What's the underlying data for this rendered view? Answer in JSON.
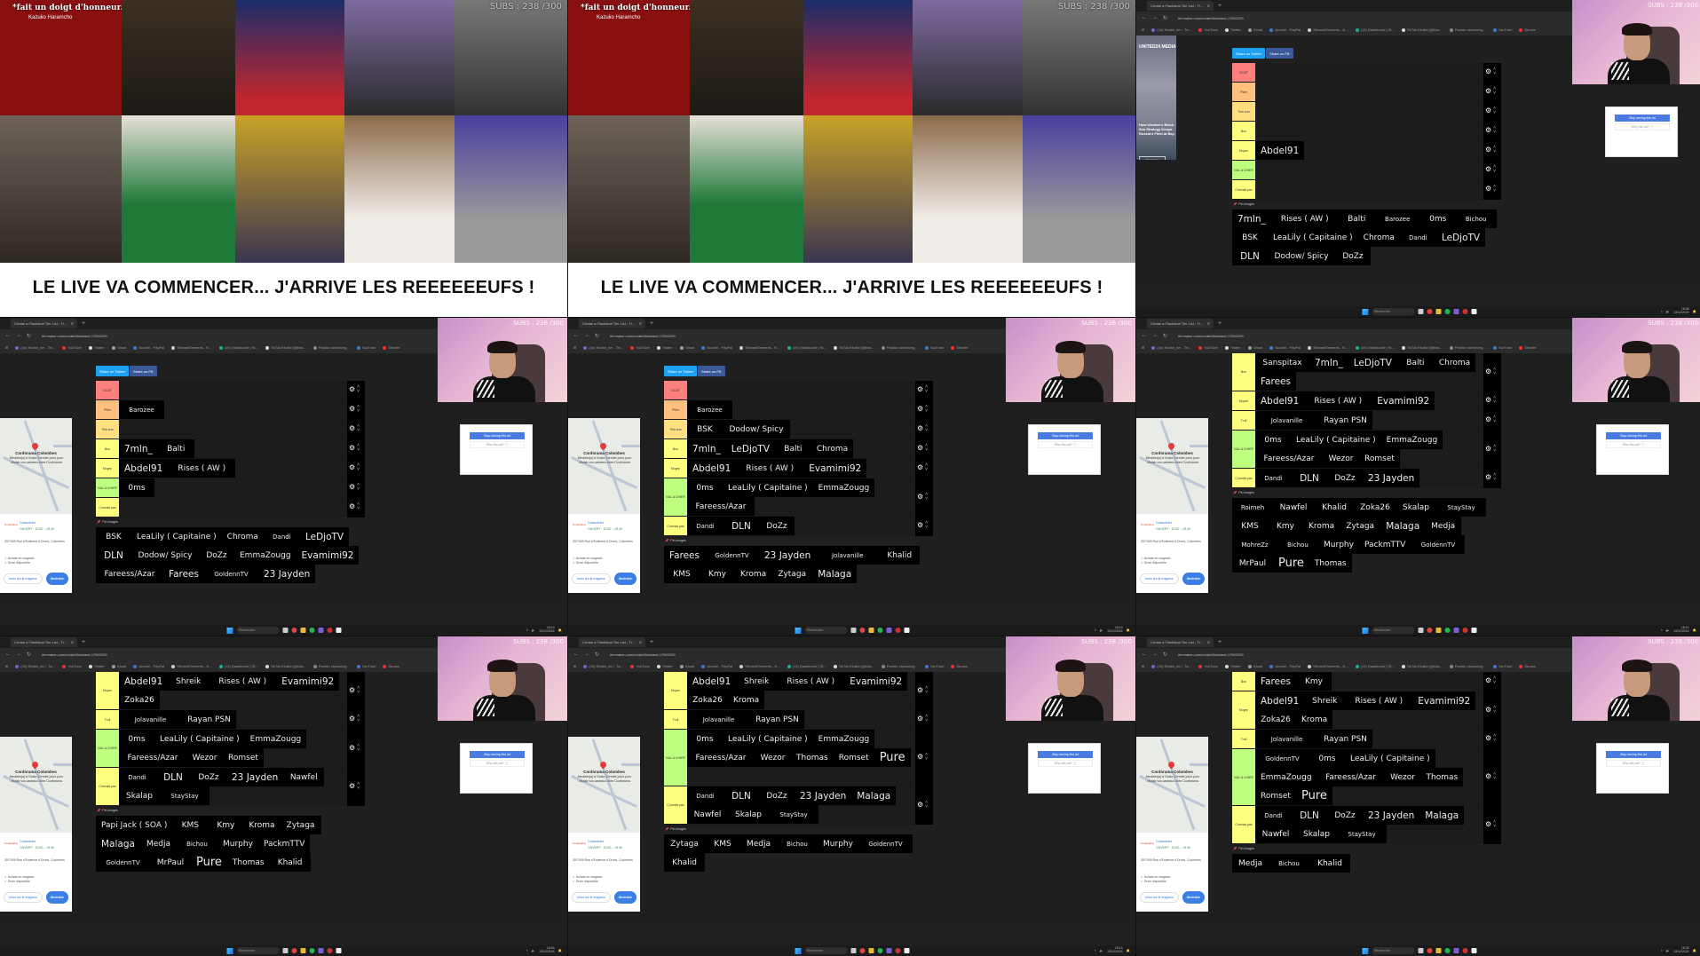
{
  "stream_overlay": {
    "subs_counter": "SUBS : 238 /300"
  },
  "intro": {
    "caption": "*fait un doigt d'honneur.*",
    "caption_sub": "Kazuko Haramcho",
    "banner": "LE LIVE VA COMMENCER... J'ARRIVE LES REEEEEEUFS !"
  },
  "browser": {
    "tab_title": "Create a Flashland Tier List - Ti...",
    "tab_close": "✕",
    "new_tab": "+",
    "url": "tiermaker.com/create/flashland-17592299",
    "bookmarks": [
      "(16) Khalid_rim - Tw...",
      "YouTube",
      "Twitter",
      "Gmail",
      "Accueil - PayPal",
      "StreamElements - N...",
      "(19) Dashboard | St...",
      "TikTok Khalid (@kha...",
      "Parrain streaming...",
      "YouTube",
      "Stream"
    ]
  },
  "tiermaker": {
    "share_twitter": "Share on Twitter",
    "share_fb": "Share on FB",
    "pin_images": "Pin Images",
    "gear_glyph": "⚙",
    "up_glyph": "˄",
    "down_glyph": "˅"
  },
  "ads": {
    "news": {
      "brand": "UNITED24 MEDIA",
      "headline": "How Ukraine's Black Sea Strategy Keeps Russia's Fleet at Bay",
      "cta": "Read more"
    },
    "map": {
      "title": "Conforama Colombes",
      "desc": "Meubles(s) à Gosto. Dernier jours pour choisir vos cadeaux chez Conforama",
      "store_logo": "Conforama",
      "store_name": "Colombes",
      "hours": "OUVERT · 10:00 – 19:30",
      "address": "357/359 Rue d'Estienne d'Orves, Colombes",
      "features": [
        "✓ Achats en magasin",
        "✓ Drive disponible"
      ],
      "info_btn": "Infos sur le magasin",
      "route_btn": "Itinéraire"
    },
    "stop_seeing": "Stop seeing this ad",
    "why_ad": "Why this ad? ⓘ"
  },
  "taskbar": {
    "search": "Rechercher",
    "clock_times": [
      "18:04",
      "18:05",
      "18:08",
      "18:10",
      "18:10",
      "18:10",
      "18:04",
      "18:13",
      "18:25"
    ],
    "date": "13/12/2024"
  },
  "tier_colors": {
    "GOAT": "#ff7f7f",
    "Pilier": "#ffbf7f",
    "Très bon": "#ffdf7f",
    "Bon": "#ffff7f",
    "Moyen": "#ffff7f",
    "Troll": "#ffff7f",
    "NUL A CHIER": "#bfff7f",
    "Connais pas": "#ffff7f"
  },
  "frames": [
    {
      "id": "f3",
      "tiers": [
        {
          "label": "GOAT",
          "items": []
        },
        {
          "label": "Pilier",
          "items": []
        },
        {
          "label": "Très bon",
          "items": []
        },
        {
          "label": "Bon",
          "items": []
        },
        {
          "label": "Moyen",
          "items": [
            "Abdel91"
          ]
        },
        {
          "label": "NUL A CHIER",
          "items": []
        },
        {
          "label": "Connais pas",
          "items": []
        }
      ],
      "pool": [
        "7mln_",
        "Rises ( AW )",
        "Balti",
        "Barozee",
        "0ms",
        "Bichou",
        "BSK",
        "LeaLily ( Capitaine )",
        "Chroma",
        "Dandi",
        "LeDjoTV",
        "DLN",
        "Dodow/ Spicy",
        "DoZz"
      ]
    },
    {
      "id": "f4",
      "tiers": [
        {
          "label": "GOAT",
          "items": []
        },
        {
          "label": "Pilier",
          "items": [
            "Barozee"
          ]
        },
        {
          "label": "Très bon",
          "items": []
        },
        {
          "label": "Bon",
          "items": [
            "7mln_",
            "Balti"
          ]
        },
        {
          "label": "Moyen",
          "items": [
            "Abdel91",
            "Rises ( AW )"
          ]
        },
        {
          "label": "NUL A CHIER",
          "items": [
            "0ms"
          ]
        },
        {
          "label": "Connais pas",
          "items": []
        }
      ],
      "pool": [
        "BSK",
        "LeaLily ( Capitaine )",
        "Chroma",
        "Dandi",
        "LeDjoTV",
        "DLN",
        "Dodow/ Spicy",
        "DoZz",
        "EmmaZougg",
        "Evamimi92",
        "Fareess/Azar",
        "Farees",
        "GoldennTV",
        "23 Jayden"
      ]
    },
    {
      "id": "f5",
      "tiers": [
        {
          "label": "GOAT",
          "items": []
        },
        {
          "label": "Pilier",
          "items": [
            "Barozee"
          ]
        },
        {
          "label": "Très bon",
          "items": [
            "BSK",
            "Dodow/ Spicy"
          ]
        },
        {
          "label": "Bon",
          "items": [
            "7mln_",
            "LeDjoTV",
            "Balti",
            "Chroma"
          ]
        },
        {
          "label": "Moyen",
          "items": [
            "Abdel91",
            "Rises ( AW )",
            "Evamimi92"
          ]
        },
        {
          "label": "NUL A CHIER",
          "items": [
            "0ms",
            "LeaLily ( Capitaine )",
            "EmmaZougg",
            "Fareess/Azar"
          ]
        },
        {
          "label": "Connais pas",
          "items": [
            "Dandi",
            "DLN",
            "DoZz"
          ]
        }
      ],
      "pool": [
        "Farees",
        "GoldennTV",
        "23 Jayden",
        "Jolavanille",
        "Khalid",
        "KMS",
        "Kmy",
        "Kroma",
        "Zytaga",
        "Malaga"
      ]
    },
    {
      "id": "f6",
      "tiers": [
        {
          "label": "Bon",
          "items": [
            "Sanspitax",
            "7mln_",
            "LeDjoTV",
            "Balti",
            "Chroma",
            "Farees"
          ]
        },
        {
          "label": "Moyen",
          "items": [
            "Abdel91",
            "Rises ( AW )",
            "Evamimi92"
          ]
        },
        {
          "label": "Troll",
          "items": [
            "Jolavanille",
            "Rayan PSN"
          ]
        },
        {
          "label": "NUL A CHIER",
          "items": [
            "0ms",
            "LeaLily ( Capitaine )",
            "EmmaZougg",
            "Fareess/Azar",
            "Wezor",
            "Romset"
          ]
        },
        {
          "label": "Connais pas",
          "items": [
            "Dandi",
            "DLN",
            "DoZz",
            "23 Jayden"
          ]
        }
      ],
      "pool": [
        "Roimeh",
        "Nawfel",
        "Khalid",
        "Zoka26",
        "Skalap",
        "StayStay",
        "KMS",
        "Kmy",
        "Kroma",
        "Zytaga",
        "Malaga",
        "Medja",
        "MohreZz",
        "Bichou",
        "Murphy",
        "PackmTTV",
        "GoldennTV",
        "MrPaul",
        "Pure",
        "Thomas"
      ]
    },
    {
      "id": "f7",
      "tiers": [
        {
          "label": "Moyen",
          "items": [
            "Abdel91",
            "Shreik",
            "Rises ( AW )",
            "Evamimi92",
            "Zoka26"
          ]
        },
        {
          "label": "Troll",
          "items": [
            "Jolavanille",
            "Rayan PSN"
          ]
        },
        {
          "label": "NUL A CHIER",
          "items": [
            "0ms",
            "LeaLily ( Capitaine )",
            "EmmaZougg",
            "Fareess/Azar",
            "Wezor",
            "Romset"
          ]
        },
        {
          "label": "Connais pas",
          "items": [
            "Dandi",
            "DLN",
            "DoZz",
            "23 Jayden",
            "Nawfel",
            "Skalap",
            "StayStay"
          ]
        }
      ],
      "pool": [
        "Papi Jack ( SOA )",
        "KMS",
        "Kmy",
        "Kroma",
        "Zytaga",
        "Malaga",
        "Medja",
        "Bichou",
        "Murphy",
        "PackmTTV",
        "GoldennTV",
        "MrPaul",
        "Pure",
        "Thomas",
        "Khalid"
      ]
    },
    {
      "id": "f8",
      "tiers": [
        {
          "label": "Moyen",
          "items": [
            "Abdel91",
            "Shreik",
            "Rises ( AW )",
            "Evamimi92",
            "Zoka26",
            "Kroma"
          ]
        },
        {
          "label": "Troll",
          "items": [
            "Jolavanille",
            "Rayan PSN"
          ]
        },
        {
          "label": "NUL A CHIER",
          "items": [
            "0ms",
            "LeaLily ( Capitaine )",
            "EmmaZougg",
            "Fareess/Azar",
            "Wezor",
            "Thomas",
            "Romset",
            "Pure"
          ]
        },
        {
          "label": "Connais pas",
          "items": [
            "Dandi",
            "DLN",
            "DoZz",
            "23 Jayden",
            "Malaga",
            "Nawfel",
            "Skalap",
            "StayStay"
          ]
        }
      ],
      "pool": [
        "Zytaga",
        "KMS",
        "Medja",
        "Bichou",
        "Murphy",
        "GoldennTV",
        "Khalid"
      ]
    },
    {
      "id": "f9",
      "tiers": [
        {
          "label": "Bon",
          "items": [
            "Farees",
            "Kmy"
          ]
        },
        {
          "label": "Moyen",
          "items": [
            "Abdel91",
            "Shreik",
            "Rises ( AW )",
            "Evamimi92",
            "Zoka26",
            "Kroma"
          ]
        },
        {
          "label": "Troll",
          "items": [
            "Jolavanille",
            "Rayan PSN"
          ]
        },
        {
          "label": "NUL A CHIER",
          "items": [
            "GoldennTV",
            "0ms",
            "LeaLily ( Capitaine )",
            "EmmaZougg",
            "Fareess/Azar",
            "Wezor",
            "Thomas",
            "Romset",
            "Pure"
          ]
        },
        {
          "label": "Connais pas",
          "items": [
            "Dandi",
            "DLN",
            "DoZz",
            "23 Jayden",
            "Malaga",
            "Nawfel",
            "Skalap",
            "StayStay"
          ]
        }
      ],
      "pool": [
        "Medja",
        "Bichou",
        "Khalid"
      ]
    }
  ]
}
